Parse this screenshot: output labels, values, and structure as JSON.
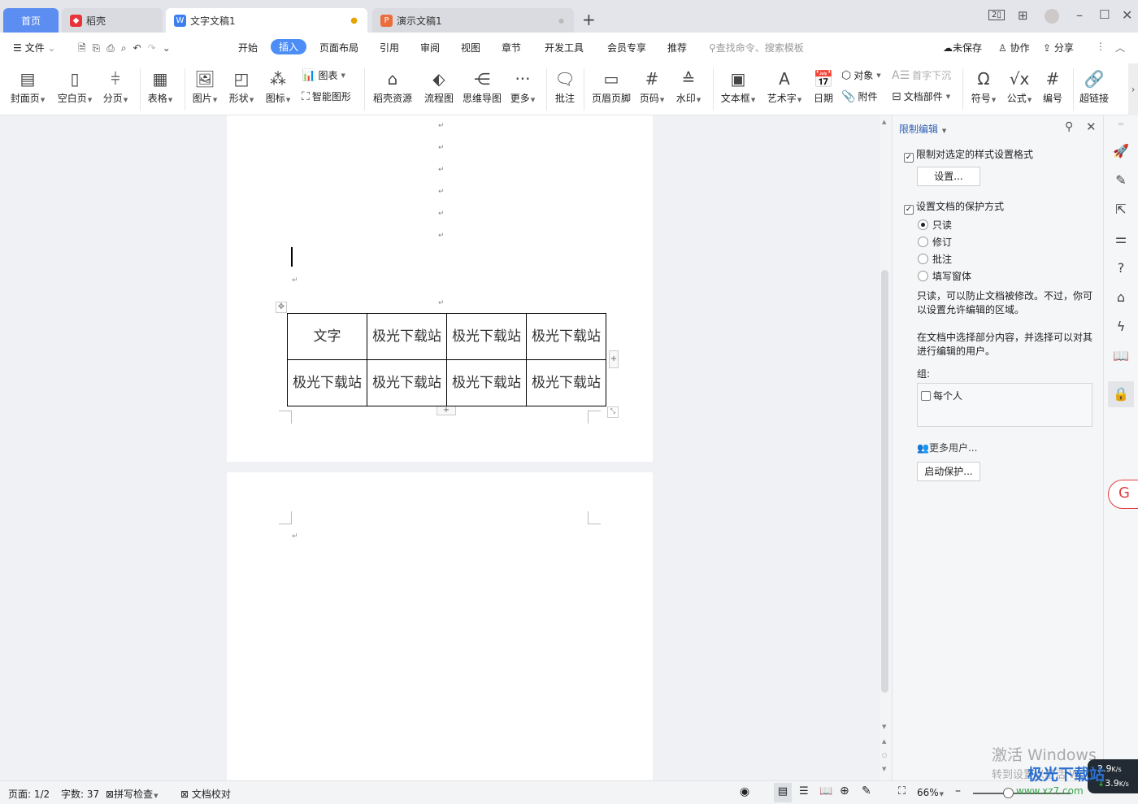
{
  "tabs": [
    {
      "label": "首页"
    },
    {
      "label": "稻壳"
    },
    {
      "label": "文字文稿1"
    },
    {
      "label": "演示文稿1"
    }
  ],
  "window_controls": {
    "page_count_badge": "2"
  },
  "menu": {
    "file": "文件",
    "items": [
      "开始",
      "插入",
      "页面布局",
      "引用",
      "审阅",
      "视图",
      "章节",
      "开发工具",
      "会员专享",
      "推荐"
    ],
    "active": "插入",
    "search_placeholder": "查找命令、搜索模板",
    "unsaved": "未保存",
    "collab": "协作",
    "share": "分享"
  },
  "ribbon": {
    "cover": "封面页",
    "blank": "空白页",
    "pagebreak": "分页",
    "table": "表格",
    "picture": "图片",
    "shape": "形状",
    "icon": "图标",
    "chart": "图表",
    "smartart": "智能图形",
    "docer": "稻壳资源",
    "flow": "流程图",
    "mindmap": "思维导图",
    "more": "更多",
    "comment": "批注",
    "header": "页眉页脚",
    "pagenum": "页码",
    "watermark": "水印",
    "textbox": "文本框",
    "wordart": "艺术字",
    "date": "日期",
    "object": "对象",
    "attach": "附件",
    "dropcap": "首字下沉",
    "docpart": "文档部件",
    "symbol": "符号",
    "formula": "公式",
    "numbering": "编号",
    "hyperlink": "超链接"
  },
  "document": {
    "table": [
      [
        "文字",
        "极光下载站",
        "极光下载站",
        "极光下载站"
      ],
      [
        "极光下载站",
        "极光下载站",
        "极光下载站",
        "极光下载站"
      ]
    ]
  },
  "pane": {
    "title": "限制编辑",
    "format_restrict": {
      "label": "限制对选定的样式设置格式",
      "checked": true
    },
    "settings_button": "设置...",
    "protect_mode": {
      "label": "设置文档的保护方式",
      "checked": true
    },
    "options": [
      {
        "label": "只读",
        "selected": true
      },
      {
        "label": "修订",
        "selected": false
      },
      {
        "label": "批注",
        "selected": false
      },
      {
        "label": "填写窗体",
        "selected": false
      }
    ],
    "desc1": "只读，可以防止文档被修改。不过，你可以设置允许编辑的区域。",
    "desc2": "在文档中选择部分内容，并选择可以对其进行编辑的用户。",
    "group_label": "组:",
    "everyone": "每个人",
    "more_users": "更多用户...",
    "start_button": "启动保护..."
  },
  "status": {
    "page": "页面: 1/2",
    "words": "字数: 37",
    "spell": "拼写检查",
    "proof": "文档校对",
    "zoom": "66%",
    "zoom_level": 0.66
  },
  "overlay": {
    "activate": "激活 Windows",
    "activate_sub": "转到设置以激活 Windows",
    "net_up": "2.9",
    "net_down": "3.9",
    "net_unit": "K/s",
    "site_logo": "极光下载站",
    "site_url": "www.xz7.com"
  }
}
